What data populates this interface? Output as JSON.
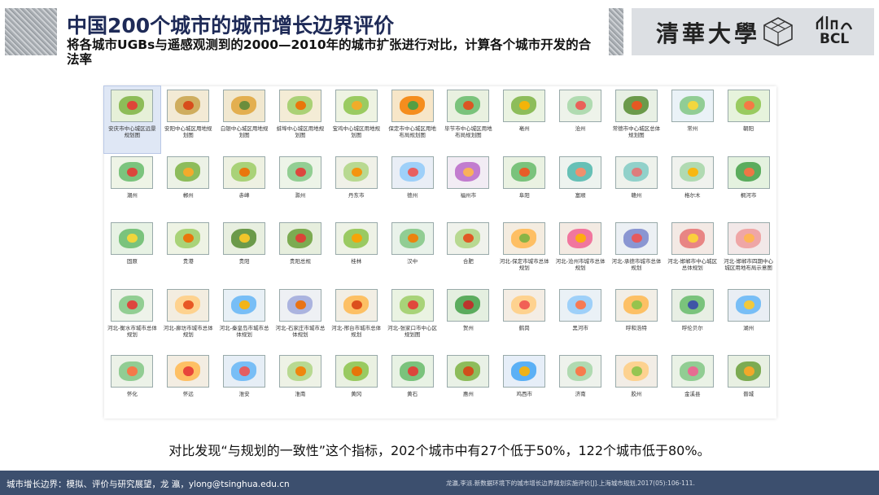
{
  "header": {
    "title": "中国200个城市的城市增长边界评价",
    "subtitle": "将各城市UGBs与遥感观测到的2000—2010年的城市扩张进行对比，计算各个城市开发的合法率"
  },
  "logos": {
    "tsinghua": "清華大學",
    "bcl": "BCL"
  },
  "maps": [
    {
      "label": "安庆市中心城区远景规划图",
      "colors": [
        "#e6f0d8",
        "#7cb342",
        "#e53935"
      ]
    },
    {
      "label": "安阳中心城区用地规划图",
      "colors": [
        "#f3ead5",
        "#c8a24a",
        "#d84315"
      ]
    },
    {
      "label": "白银中心城区用地规划图",
      "colors": [
        "#f1e8d0",
        "#e0a43a",
        "#5d8a3a"
      ]
    },
    {
      "label": "蚌埠中心城区用地规划图",
      "colors": [
        "#f4ecd6",
        "#9ccc65",
        "#ef6c00"
      ]
    },
    {
      "label": "宝鸡中心城区用地规划图",
      "colors": [
        "#eef3e2",
        "#8bc34a",
        "#f9a825"
      ]
    },
    {
      "label": "保定市中心城区用地布局规划图",
      "colors": [
        "#f7e6c8",
        "#f57c00",
        "#43a047"
      ]
    },
    {
      "label": "毕节市中心城区用地布局规划图",
      "colors": [
        "#e9f1e0",
        "#66bb6a",
        "#e64a19"
      ]
    },
    {
      "label": "亳州",
      "colors": [
        "#eaf3e1",
        "#7cb342",
        "#ffb300"
      ]
    },
    {
      "label": "沧州",
      "colors": [
        "#eef3ea",
        "#a5d6a7",
        "#ef5350"
      ]
    },
    {
      "label": "常德市中心城区总体规划图",
      "colors": [
        "#e8f0e4",
        "#558b2f",
        "#f4511e"
      ]
    },
    {
      "label": "常州",
      "colors": [
        "#eaf2f7",
        "#81c784",
        "#fdd835"
      ]
    },
    {
      "label": "朝阳",
      "colors": [
        "#e6f3dc",
        "#8bc34a",
        "#ff7043"
      ]
    },
    {
      "label": "潮州",
      "colors": [
        "#eef4e6",
        "#66bb6a",
        "#e53935"
      ]
    },
    {
      "label": "郴州",
      "colors": [
        "#ecf2e6",
        "#7cb342",
        "#ffa726"
      ]
    },
    {
      "label": "赤峰",
      "colors": [
        "#eef1e2",
        "#9ccc65",
        "#ef6c00"
      ]
    },
    {
      "label": "滁州",
      "colors": [
        "#edf4e8",
        "#81c784",
        "#e53935"
      ]
    },
    {
      "label": "丹东市",
      "colors": [
        "#f0f1e8",
        "#aed581",
        "#fb8c00"
      ]
    },
    {
      "label": "德州",
      "colors": [
        "#e9eef6",
        "#90caf9",
        "#ef5350"
      ]
    },
    {
      "label": "福州市",
      "colors": [
        "#f2ecf4",
        "#ba68c8",
        "#ffb74d"
      ]
    },
    {
      "label": "阜阳",
      "colors": [
        "#eaf2e2",
        "#66bb6a",
        "#f4511e"
      ]
    },
    {
      "label": "富顺",
      "colors": [
        "#edf3ef",
        "#4db6ac",
        "#ff8a65"
      ]
    },
    {
      "label": "赣州",
      "colors": [
        "#eef2ec",
        "#80cbc4",
        "#e57373"
      ]
    },
    {
      "label": "格尔木",
      "colors": [
        "#f0f2ee",
        "#a5d6a7",
        "#ffb300"
      ]
    },
    {
      "label": "桐河市",
      "colors": [
        "#e4f2df",
        "#43a047",
        "#ff7043"
      ]
    },
    {
      "label": "固原",
      "colors": [
        "#e7f2e4",
        "#66bb6a",
        "#fdd835"
      ]
    },
    {
      "label": "贵港",
      "colors": [
        "#eef3e4",
        "#9ccc65",
        "#ef6c00"
      ]
    },
    {
      "label": "贵阳",
      "colors": [
        "#e8efe0",
        "#558b2f",
        "#ffca28"
      ]
    },
    {
      "label": "贵阳总规",
      "colors": [
        "#e6eedd",
        "#689f38",
        "#e53935"
      ]
    },
    {
      "label": "桂林",
      "colors": [
        "#eef2e6",
        "#8bc34a",
        "#ffa000"
      ]
    },
    {
      "label": "汉中",
      "colors": [
        "#e9f2ea",
        "#81c784",
        "#f57c00"
      ]
    },
    {
      "label": "合肥",
      "colors": [
        "#f0f2ec",
        "#aed581",
        "#e64a19"
      ]
    },
    {
      "label": "河北-保定市城市总体规划",
      "colors": [
        "#f4ece0",
        "#ffb74d",
        "#7cb342"
      ]
    },
    {
      "label": "河北-沧州市城市总体规划",
      "colors": [
        "#f3eae2",
        "#f06292",
        "#ffb300"
      ]
    },
    {
      "label": "河北-承德市城市总体规划",
      "colors": [
        "#ecf0f4",
        "#7986cb",
        "#ef5350"
      ]
    },
    {
      "label": "河北-邯郸市中心城区总体规划",
      "colors": [
        "#f3e9e4",
        "#e57373",
        "#fdd835"
      ]
    },
    {
      "label": "河北-邯郸市四期中心城区用地布局示意图",
      "colors": [
        "#f2e8e8",
        "#ef9a9a",
        "#ffb74d"
      ]
    },
    {
      "label": "河北-衡水市城市总体规划",
      "colors": [
        "#eef3ea",
        "#81c784",
        "#e53935"
      ]
    },
    {
      "label": "河北-廊坊市城市总体规划",
      "colors": [
        "#f3ede0",
        "#ffcc80",
        "#e64a19"
      ]
    },
    {
      "label": "河北-秦皇岛市城市总体规划",
      "colors": [
        "#e8f0f6",
        "#64b5f6",
        "#ffb300"
      ]
    },
    {
      "label": "河北-石家庄市城市总体规划",
      "colors": [
        "#eef0f4",
        "#9fa8da",
        "#ef6c00"
      ]
    },
    {
      "label": "河北-邢台市城市总体规划",
      "colors": [
        "#f2eee4",
        "#ffb74d",
        "#d84315"
      ]
    },
    {
      "label": "河北-张家口市中心区规划图",
      "colors": [
        "#eaf3e2",
        "#9ccc65",
        "#e53935"
      ]
    },
    {
      "label": "贺州",
      "colors": [
        "#e4efe0",
        "#43a047",
        "#c62828"
      ]
    },
    {
      "label": "鹤岗",
      "colors": [
        "#f4ede4",
        "#ffcc80",
        "#ef5350"
      ]
    },
    {
      "label": "黑河市",
      "colors": [
        "#eaf1f6",
        "#90caf9",
        "#ff7043"
      ]
    },
    {
      "label": "呼和浩特",
      "colors": [
        "#f2eee6",
        "#ffb74d",
        "#8bc34a"
      ]
    },
    {
      "label": "呼伦贝尔",
      "colors": [
        "#e8efe4",
        "#66bb6a",
        "#3949ab"
      ]
    },
    {
      "label": "湖州",
      "colors": [
        "#e9eef4",
        "#64b5f6",
        "#ffca28"
      ]
    },
    {
      "label": "怀化",
      "colors": [
        "#ecf2e8",
        "#81c784",
        "#ff7043"
      ]
    },
    {
      "label": "怀远",
      "colors": [
        "#f3ede2",
        "#ffb74d",
        "#e53935"
      ]
    },
    {
      "label": "淮安",
      "colors": [
        "#e6eef6",
        "#64b5f6",
        "#ef5350"
      ]
    },
    {
      "label": "淮南",
      "colors": [
        "#eef2e6",
        "#aed581",
        "#f57c00"
      ]
    },
    {
      "label": "黄冈",
      "colors": [
        "#eaf1e2",
        "#8bc34a",
        "#ef6c00"
      ]
    },
    {
      "label": "黄石",
      "colors": [
        "#e8f2e4",
        "#66bb6a",
        "#e53935"
      ]
    },
    {
      "label": "惠州",
      "colors": [
        "#e9f1e6",
        "#7cb342",
        "#d84315"
      ]
    },
    {
      "label": "鸡西市",
      "colors": [
        "#e6eef8",
        "#42a5f5",
        "#ffb300"
      ]
    },
    {
      "label": "济南",
      "colors": [
        "#eef2ec",
        "#a5d6a7",
        "#ff7043"
      ]
    },
    {
      "label": "胶州",
      "colors": [
        "#f2ede6",
        "#ffcc80",
        "#8bc34a"
      ]
    },
    {
      "label": "金溪县",
      "colors": [
        "#eaf2e6",
        "#81c784",
        "#f06292"
      ]
    },
    {
      "label": "晋城",
      "colors": [
        "#e8f0e2",
        "#689f38",
        "#ffa726"
      ]
    }
  ],
  "conclusion": "对比发现“与规划的一致性”这个指标，202个城市中有27个低于50%，122个城市低于80%。",
  "footer": {
    "left": "城市增长边界：模拟、评价与研究展望，龙 瀛，ylong@tsinghua.edu.cn",
    "right": "龙瀛,李派.新数据环境下的城市增长边界规划实施评价[J].上海城市规划,2017(05):106-111."
  }
}
